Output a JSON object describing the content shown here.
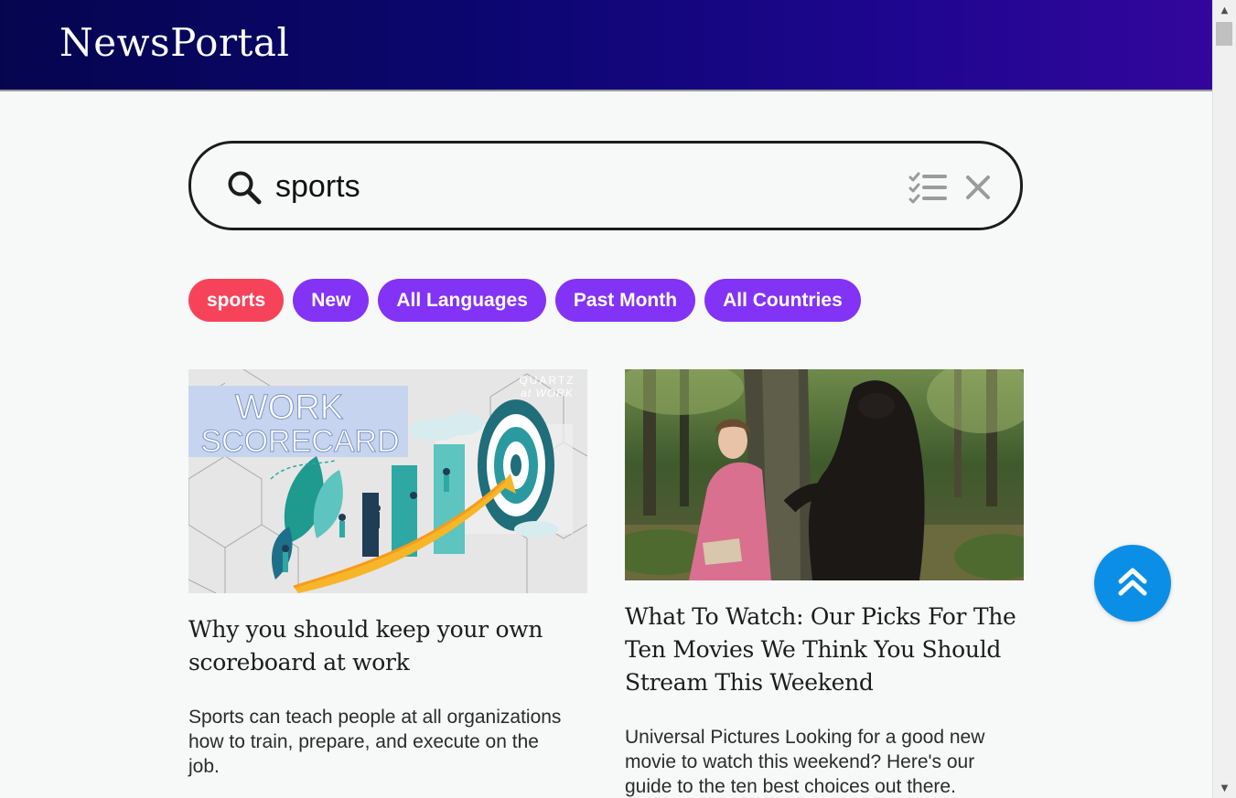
{
  "header": {
    "brand": "NewsPortal",
    "background_colors": [
      "#05054f",
      "#33069c"
    ]
  },
  "search": {
    "value": "sports",
    "placeholder": "",
    "search_icon": "search-icon",
    "filter_icon": "filter-list-icon",
    "clear_icon": "close-icon"
  },
  "chips": [
    {
      "label": "sports",
      "color": "#f7435a",
      "active": true
    },
    {
      "label": "New",
      "color": "#8333f5",
      "active": false
    },
    {
      "label": "All Languages",
      "color": "#8333f5",
      "active": false
    },
    {
      "label": "Past Month",
      "color": "#8333f5",
      "active": false
    },
    {
      "label": "All Countries",
      "color": "#8333f5",
      "active": false
    }
  ],
  "articles": [
    {
      "image_text_main": "WORK SCORECARD",
      "image_text_logo": "QUARTZ at WORK",
      "image_text_main_line1": "WORK",
      "image_text_main_line2": "SCORECARD",
      "image_text_logo_line1": "QUARTZ",
      "image_text_logo_line2": "at WORK",
      "title_line1": "Why you should keep your own",
      "title_line2": "scoreboard at work",
      "description_line1": "Sports can teach people at all organizations",
      "description_line2": "how to train, prepare, and execute on the",
      "description_line3": "job."
    },
    {
      "title_line1": "What To Watch: Our Picks For The",
      "title_line2": "Ten Movies We Think You Should",
      "title_line3": "Stream This Weekend",
      "description_line1": "Universal Pictures Looking for a good new",
      "description_line2": "movie to watch this weekend? Here's our",
      "description_line3": "guide to the ten best choices out there."
    }
  ],
  "back_to_top": {
    "icon": "double-chevron-up-icon",
    "color": "#0b8ee6"
  }
}
